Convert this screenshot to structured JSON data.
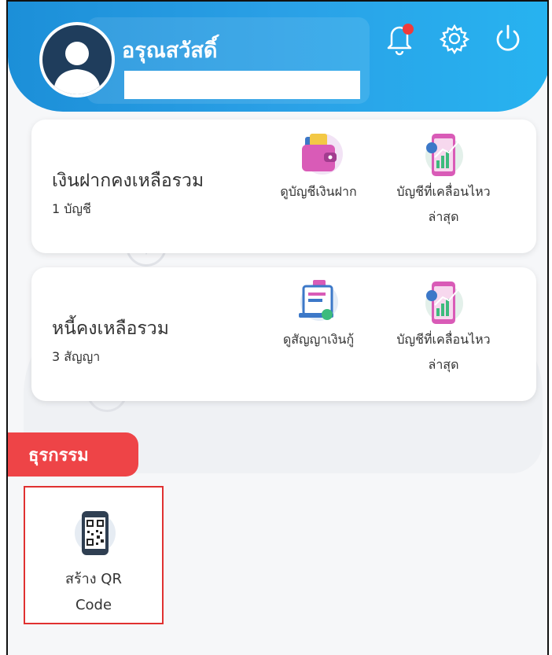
{
  "header": {
    "greeting": "อรุณสวัสดิ์",
    "icons": [
      "bell-icon",
      "settings-gear-icon",
      "power-icon"
    ],
    "notification_dot_color": "#ef3b3b"
  },
  "deposit_card": {
    "title": "เงินฝากคงเหลือรวม",
    "subtitle": "1 บัญชี",
    "actions": [
      {
        "label": "ดูบัญชีเงินฝาก",
        "icon": "wallet-icon"
      },
      {
        "label": "บัญชีที่เคลื่อนไหว",
        "label2": "ล่าสุด",
        "icon": "phone-chart-icon"
      }
    ]
  },
  "loan_card": {
    "title": "หนี้คงเหลือรวม",
    "subtitle": "3 สัญญา",
    "actions": [
      {
        "label": "ดูสัญญาเงินกู้",
        "icon": "loan-contract-icon"
      },
      {
        "label": "บัญชีที่เคลื่อนไหว",
        "label2": "ล่าสุด",
        "icon": "phone-chart-icon"
      }
    ]
  },
  "transactions": {
    "section_title": "ธุรกรรม",
    "items": [
      {
        "label": "สร้าง QR",
        "label2": "Code",
        "icon": "qr-code-phone-icon"
      }
    ]
  },
  "colors": {
    "header_blue": "#1c8fd8",
    "accent_red": "#ee4447"
  }
}
